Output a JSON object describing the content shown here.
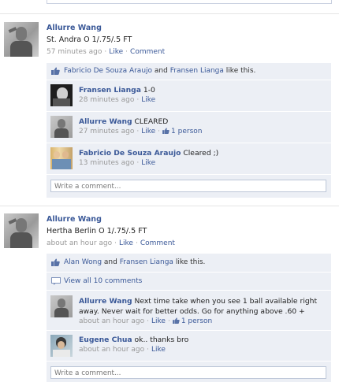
{
  "story1": {
    "author": "Allurre Wang",
    "text": "St. Andra O 1/.75/.5 FT",
    "time": "57 minutes ago",
    "like": "Like",
    "comment": "Comment",
    "likes": {
      "user1": "Fabricio De Souza Araujo",
      "and": "and",
      "user2": "Fransen Lianga",
      "suffix": "like this."
    },
    "comments": [
      {
        "author": "Fransen Lianga",
        "text": "1-0",
        "time": "28 minutes ago",
        "like": "Like"
      },
      {
        "author": "Allurre Wang",
        "text": "CLEARED",
        "time": "27 minutes ago",
        "like": "Like",
        "likes_count": "1 person"
      },
      {
        "author": "Fabricio De Souza Araujo",
        "text": "Cleared ;)",
        "time": "13 minutes ago",
        "like": "Like"
      }
    ],
    "write_placeholder": "Write a comment..."
  },
  "story2": {
    "author": "Allurre Wang",
    "text": "Hertha Berlin O 1/.75/.5 FT",
    "time": "about an hour ago",
    "like": "Like",
    "comment": "Comment",
    "likes": {
      "user1": "Alan Wong",
      "and": "and",
      "user2": "Fransen Lianga",
      "suffix": "like this."
    },
    "view_all": "View all 10 comments",
    "comments": [
      {
        "author": "Allurre Wang",
        "text_line1": "Next time take when you see 1 ball available right",
        "text_line2": "away. Never wait for better odds. Go for anything above .60 +",
        "time": "about an hour ago",
        "like": "Like",
        "likes_count": "1 person"
      },
      {
        "author": "Eugene Chua",
        "text": "ok.. thanks bro",
        "time": "about an hour ago",
        "like": "Like"
      }
    ],
    "write_placeholder": "Write a comment..."
  }
}
